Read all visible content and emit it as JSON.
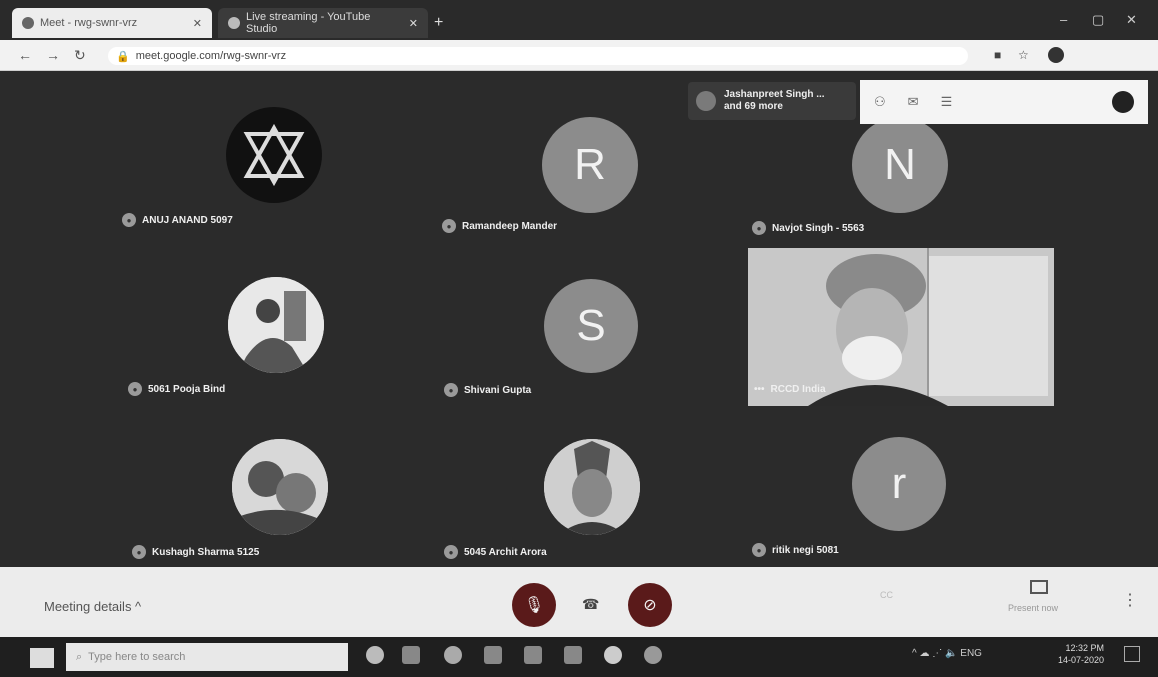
{
  "browser": {
    "tabs": [
      {
        "title": "Meet - rwg-swnr-vrz"
      },
      {
        "title": "Live streaming - YouTube Studio"
      }
    ],
    "new_tab": "+",
    "window_controls": [
      "–",
      "▢",
      "✕"
    ],
    "url": "meet.google.com/rwg-swnr-vrz"
  },
  "meet": {
    "participant_badge": {
      "line1": "Jashanpreet Singh ...",
      "line2": "and 69 more"
    },
    "participants": [
      {
        "name": "ANUJ ANAND 5097",
        "avatar_letter": ""
      },
      {
        "name": "Ramandeep Mander",
        "avatar_letter": "R"
      },
      {
        "name": "Navjot Singh - 5563",
        "avatar_letter": "N"
      },
      {
        "name": "5061 Pooja Bind",
        "avatar_letter": ""
      },
      {
        "name": "Shivani Gupta",
        "avatar_letter": "S"
      },
      {
        "name": "RCCD India",
        "avatar_letter": ""
      },
      {
        "name": "Kushagh Sharma 5125",
        "avatar_letter": ""
      },
      {
        "name": "5045 Archit Arora",
        "avatar_letter": ""
      },
      {
        "name": "ritik negi 5081",
        "avatar_letter": "r"
      }
    ],
    "meeting_details": "Meeting details  ^",
    "present_now": "Present now"
  },
  "taskbar": {
    "search_placeholder": "Type here to search",
    "tray_lang": "ENG",
    "time": "12:32 PM",
    "date": "14-07-2020"
  }
}
